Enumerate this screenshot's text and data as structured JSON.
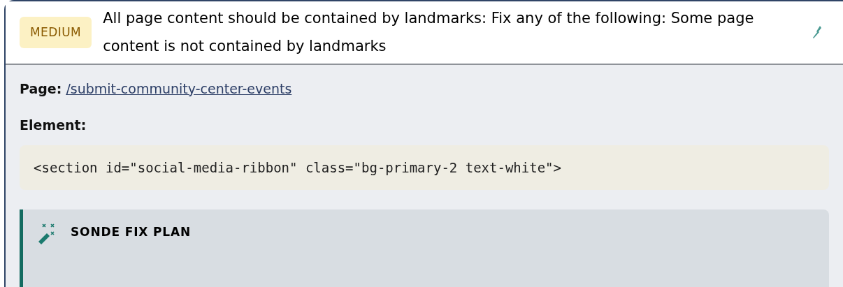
{
  "issue": {
    "severity": "MEDIUM",
    "title": "All page content should be contained by landmarks: Fix any of the following: Some page content is not contained by landmarks"
  },
  "details": {
    "page_label": "Page:",
    "page_link": "/submit-community-center-events",
    "element_label": "Element:",
    "element_code": "<section id=\"social-media-ribbon\" class=\"bg-primary-2 text-white\">"
  },
  "fix_plan": {
    "title": "SONDE FIX PLAN"
  }
}
